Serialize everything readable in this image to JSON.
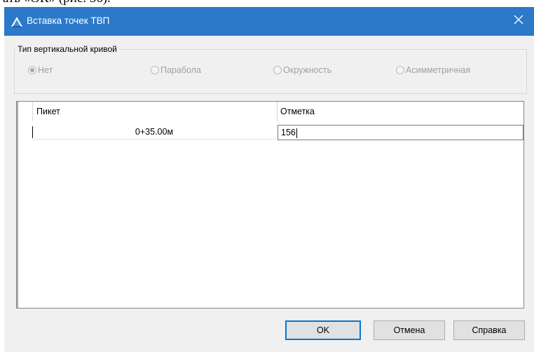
{
  "background_fragment": "ать «ОК» (рис. 56).",
  "window": {
    "title": "Вставка точек ТВП",
    "app_icon": "civil-triangle-icon",
    "close_icon": "close-icon",
    "titlebar_color": "#2b79c8"
  },
  "curve_type": {
    "label": "Тип вертикальной кривой",
    "options": [
      {
        "label": "Нет",
        "selected": true
      },
      {
        "label": "Парабола",
        "selected": false
      },
      {
        "label": "Окружность",
        "selected": false
      },
      {
        "label": "Асимметричная",
        "selected": false
      }
    ],
    "disabled": true
  },
  "grid": {
    "columns": [
      "Пикет",
      "Отметка"
    ],
    "rows": [
      {
        "picket": "0+35.00м",
        "mark": "156"
      }
    ]
  },
  "buttons": {
    "ok": "OK",
    "cancel": "Отмена",
    "help": "Справка"
  },
  "colors": {
    "accent": "#0078d7",
    "dialog_bg": "#f0f0f0"
  }
}
